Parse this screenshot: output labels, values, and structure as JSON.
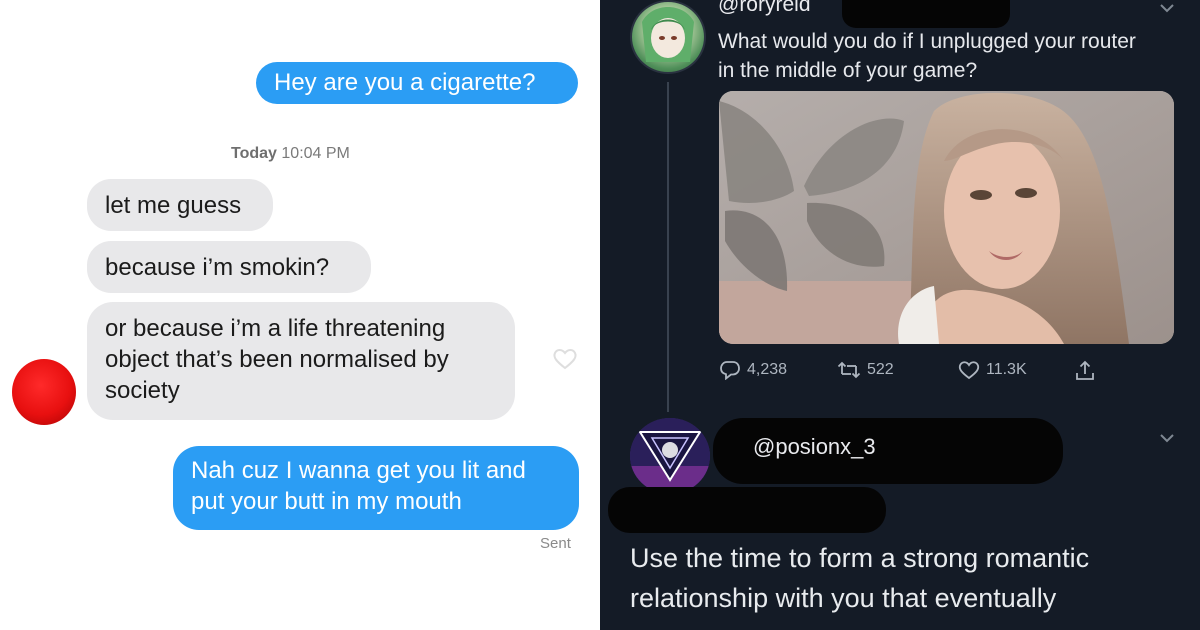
{
  "imessage": {
    "messages": [
      {
        "direction": "sent",
        "text": "Hey are you a cigarette?"
      },
      {
        "direction": "received",
        "text": "let me guess"
      },
      {
        "direction": "received",
        "text": "because i’m smokin?"
      },
      {
        "direction": "received",
        "lines": [
          "or because i’m a life threatening",
          "object that’s been normalised by",
          "society"
        ]
      },
      {
        "direction": "sent",
        "lines": [
          "Nah cuz I wanna get you lit and",
          "put your butt in my mouth"
        ]
      }
    ],
    "timestamp_day": "Today",
    "timestamp_time": "10:04 PM",
    "delivery_status": "Sent",
    "colors": {
      "sent_bubble": "#2b9df4",
      "received_bubble": "#e8e8ea"
    }
  },
  "tweet": {
    "author_handle": "@roryreid",
    "text_lines": [
      "What would you do if I unplugged your router",
      "in the middle of your game?"
    ],
    "stats": {
      "replies": "4,238",
      "retweets": "522",
      "likes": "11.3K"
    },
    "icons": {
      "reply": "reply-icon",
      "retweet": "retweet-icon",
      "like": "heart-icon",
      "share": "share-icon"
    }
  },
  "reply": {
    "author_handle": "@posionx_3",
    "text_lines": [
      "Use the time to form a strong romantic",
      "relationship with you that eventually"
    ]
  },
  "colors": {
    "tweet_background": "#141b26",
    "tweet_text": "#e8ebee",
    "muted_text": "#aeb6c0"
  }
}
